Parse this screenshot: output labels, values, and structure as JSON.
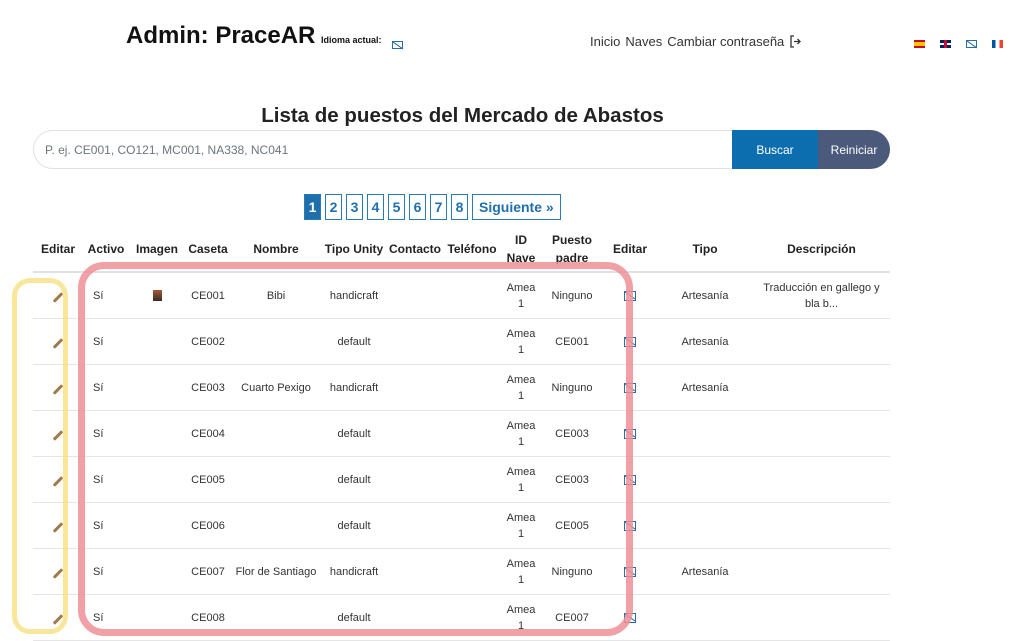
{
  "header": {
    "brand": "Admin: PraceAR",
    "language_label": "Idioma actual:",
    "nav": [
      "Inicio",
      "Naves",
      "Cambiar contraseña"
    ],
    "logout_icon": "logout-icon",
    "flags": [
      "es",
      "gb",
      "gl",
      "fr"
    ]
  },
  "page": {
    "title": "Lista de puestos del Mercado de Abastos"
  },
  "search": {
    "placeholder": "P. ej. CE001, CO121, MC001, NA338, NC041",
    "value": "",
    "search_label": "Buscar",
    "reset_label": "Reiniciar"
  },
  "pagination": {
    "pages": [
      "1",
      "2",
      "3",
      "4",
      "5",
      "6",
      "7",
      "8"
    ],
    "active": "1",
    "next_label": "Siguiente »"
  },
  "table": {
    "headers": [
      "Editar",
      "Activo",
      "Imagen",
      "Caseta",
      "Nombre",
      "Tipo Unity",
      "Contacto",
      "Teléfono",
      "ID Nave",
      "Puesto padre",
      "Editar",
      "Tipo",
      "Descripción"
    ],
    "rows": [
      {
        "activo": "Sí",
        "imagen": true,
        "caseta": "CE001",
        "nombre": "Bibi",
        "tipo_unity": "handicraft",
        "contacto": "",
        "telefono": "",
        "id_nave": "Amea 1",
        "puesto_padre": "Ninguno",
        "tipo": "Artesanía",
        "descripcion": "Traducción en gallego y bla b..."
      },
      {
        "activo": "Sí",
        "imagen": false,
        "caseta": "CE002",
        "nombre": "",
        "tipo_unity": "default",
        "contacto": "",
        "telefono": "",
        "id_nave": "Amea 1",
        "puesto_padre": "CE001",
        "tipo": "Artesanía",
        "descripcion": ""
      },
      {
        "activo": "Sí",
        "imagen": false,
        "caseta": "CE003",
        "nombre": "Cuarto Pexigo",
        "tipo_unity": "handicraft",
        "contacto": "",
        "telefono": "",
        "id_nave": "Amea 1",
        "puesto_padre": "Ninguno",
        "tipo": "Artesanía",
        "descripcion": ""
      },
      {
        "activo": "Sí",
        "imagen": false,
        "caseta": "CE004",
        "nombre": "",
        "tipo_unity": "default",
        "contacto": "",
        "telefono": "",
        "id_nave": "Amea 1",
        "puesto_padre": "CE003",
        "tipo": "",
        "descripcion": ""
      },
      {
        "activo": "Sí",
        "imagen": false,
        "caseta": "CE005",
        "nombre": "",
        "tipo_unity": "default",
        "contacto": "",
        "telefono": "",
        "id_nave": "Amea 1",
        "puesto_padre": "CE003",
        "tipo": "",
        "descripcion": ""
      },
      {
        "activo": "Sí",
        "imagen": false,
        "caseta": "CE006",
        "nombre": "",
        "tipo_unity": "default",
        "contacto": "",
        "telefono": "",
        "id_nave": "Amea 1",
        "puesto_padre": "CE005",
        "tipo": "",
        "descripcion": ""
      },
      {
        "activo": "Sí",
        "imagen": false,
        "caseta": "CE007",
        "nombre": "Flor de Santiago",
        "tipo_unity": "handicraft",
        "contacto": "",
        "telefono": "",
        "id_nave": "Amea 1",
        "puesto_padre": "Ninguno",
        "tipo": "Artesanía",
        "descripcion": ""
      },
      {
        "activo": "Sí",
        "imagen": false,
        "caseta": "CE008",
        "nombre": "",
        "tipo_unity": "default",
        "contacto": "",
        "telefono": "",
        "id_nave": "Amea 1",
        "puesto_padre": "CE007",
        "tipo": "",
        "descripcion": ""
      }
    ]
  },
  "annotations": {
    "yellow_highlight_color": "#f7e38a",
    "red_highlight_color": "#ee8f97"
  }
}
